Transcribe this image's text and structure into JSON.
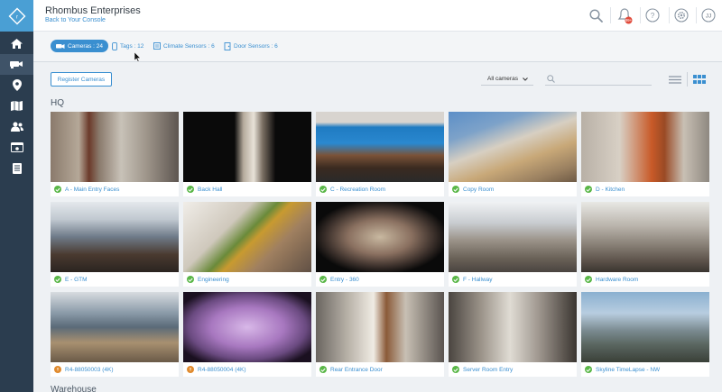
{
  "header": {
    "org_name": "Rhombus Enterprises",
    "back_link": "Back to Your Console",
    "notification_count": "99+",
    "user_initials": "JJ"
  },
  "sidebar": {
    "items": [
      {
        "icon": "home-icon"
      },
      {
        "icon": "camera-icon",
        "active": true
      },
      {
        "icon": "location-pin-icon"
      },
      {
        "icon": "map-icon"
      },
      {
        "icon": "users-icon"
      },
      {
        "icon": "video-player-icon"
      },
      {
        "icon": "report-icon"
      }
    ]
  },
  "tabs": [
    {
      "label": "Cameras : 24",
      "icon": "camera-icon",
      "active": true
    },
    {
      "label": "Tags : 12",
      "icon": "tag-icon"
    },
    {
      "label": "Climate Sensors : 6",
      "icon": "climate-sensor-icon"
    },
    {
      "label": "Door Sensors : 6",
      "icon": "door-sensor-icon"
    }
  ],
  "toolbar": {
    "register_label": "Register Cameras",
    "filter_value": "All cameras",
    "search_placeholder": ""
  },
  "sections": [
    {
      "title": "HQ",
      "cameras": [
        {
          "name": "A - Main Entry Faces",
          "status": "online"
        },
        {
          "name": "Back Hall",
          "status": "online"
        },
        {
          "name": "C - Recreation Room",
          "status": "online"
        },
        {
          "name": "Copy Room",
          "status": "online"
        },
        {
          "name": "D - Kitchen",
          "status": "online"
        },
        {
          "name": "E - GTM",
          "status": "online"
        },
        {
          "name": "Engineering",
          "status": "online"
        },
        {
          "name": "Entry - 360",
          "status": "online"
        },
        {
          "name": "F - Hallway",
          "status": "online"
        },
        {
          "name": "Hardware Room",
          "status": "online"
        },
        {
          "name": "R4-88050003 (4K)",
          "status": "warning"
        },
        {
          "name": "R4-88050004 (4K)",
          "status": "warning"
        },
        {
          "name": "Rear Entrance Door",
          "status": "online"
        },
        {
          "name": "Server Room Entry",
          "status": "online"
        },
        {
          "name": "Skyline TimeLapse - NW",
          "status": "online"
        }
      ]
    },
    {
      "title": "Warehouse",
      "cameras": []
    }
  ],
  "colors": {
    "accent": "#3a8fd0",
    "sidebar": "#2b3d4f",
    "online": "#5ab748",
    "warning": "#e08a2d"
  }
}
